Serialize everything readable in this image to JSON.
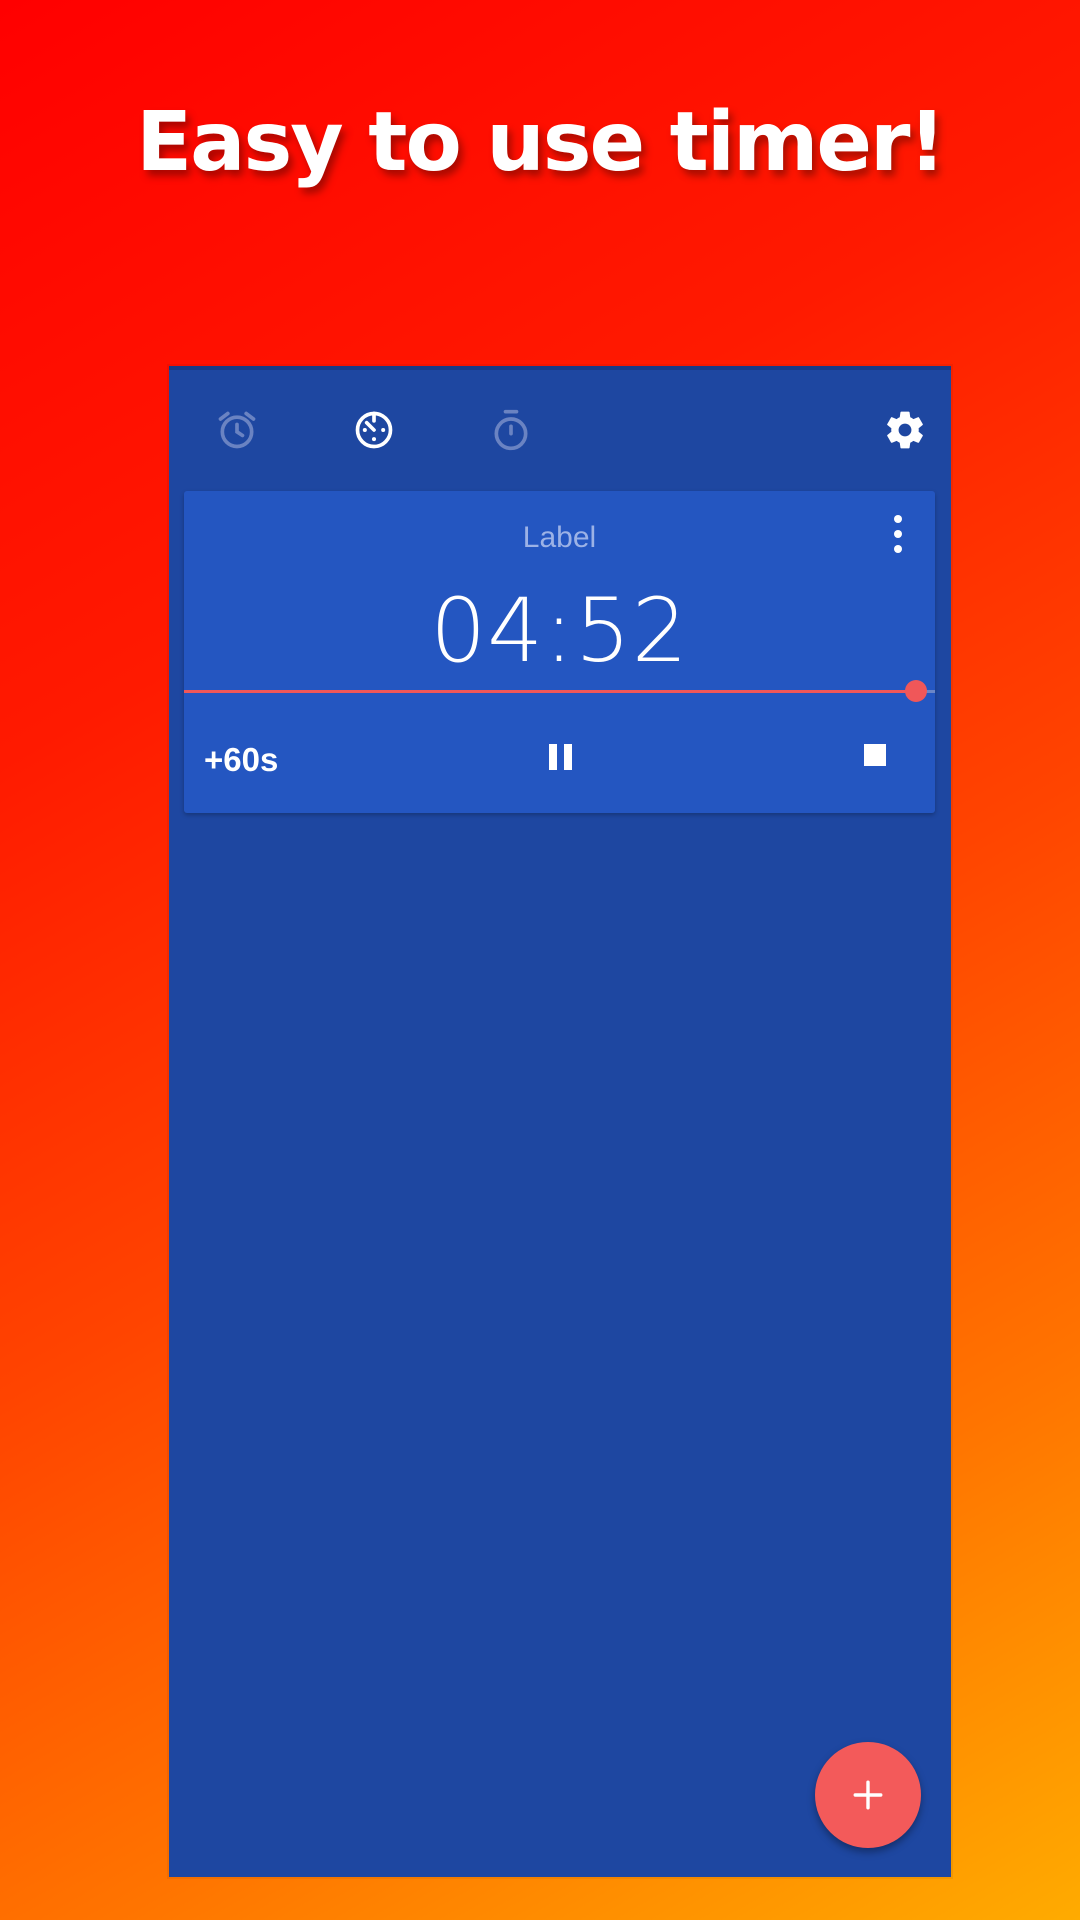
{
  "promo": {
    "headline": "Easy to use timer!"
  },
  "toolbar": {
    "tabs": [
      {
        "name": "alarm",
        "icon": "alarm-clock-icon",
        "active": false
      },
      {
        "name": "timer",
        "icon": "timer-icon",
        "active": true
      },
      {
        "name": "stopwatch",
        "icon": "stopwatch-icon",
        "active": false
      }
    ],
    "settings_icon": "gear-icon"
  },
  "timer_card": {
    "label": "Label",
    "time": "04:52",
    "progress": 0.975,
    "add_time_label": "+60s",
    "pause_icon": "pause-icon",
    "stop_icon": "stop-icon",
    "menu_icon": "more-vert-icon"
  },
  "fab": {
    "icon": "plus-icon"
  },
  "colors": {
    "background_top": "#ff0000",
    "background_bottom": "#ffab00",
    "app_background": "#1e47a1",
    "card_background": "#2456c1",
    "accent": "#f05759",
    "inactive_icon": "#6a83c2"
  }
}
